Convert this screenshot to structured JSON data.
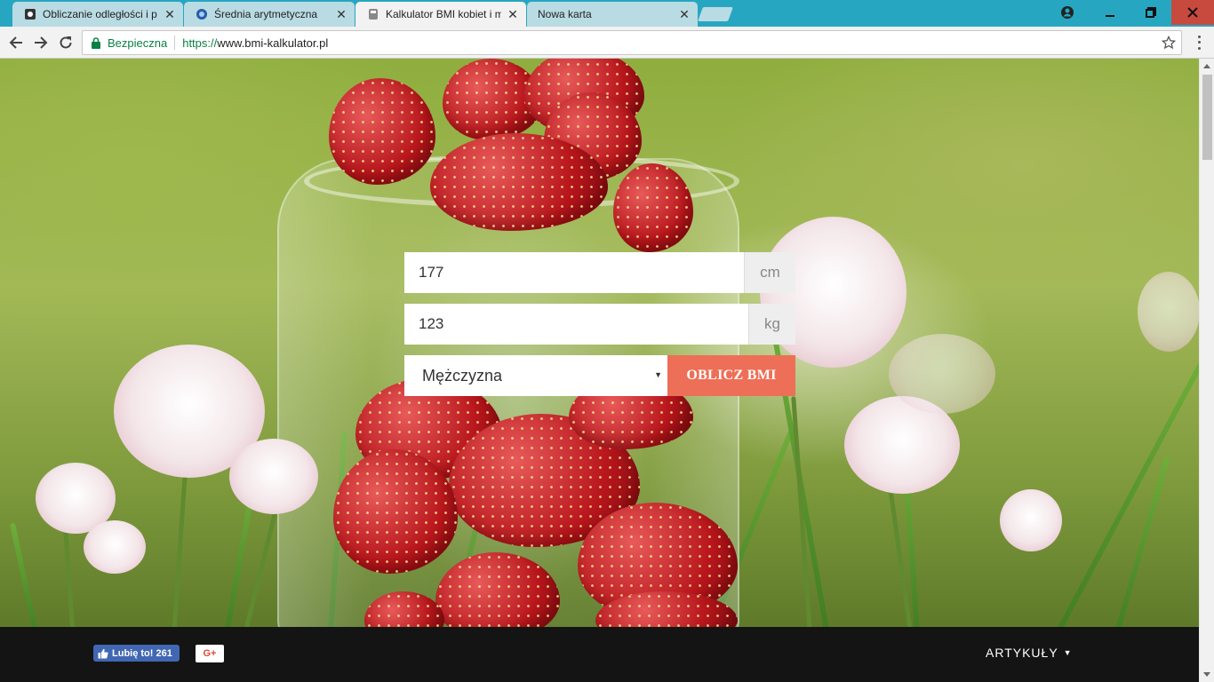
{
  "browser": {
    "tabs": [
      {
        "label": "Obliczanie odległości i p"
      },
      {
        "label": "Średnia arytmetyczna"
      },
      {
        "label": "Kalkulator BMI kobiet i m"
      },
      {
        "label": "Nowa karta"
      }
    ],
    "security_label": "Bezpieczna",
    "url_scheme": "https://",
    "url_host": "www.bmi-kalkulator.pl"
  },
  "form": {
    "height_value": "177",
    "height_unit": "cm",
    "weight_value": "123",
    "weight_unit": "kg",
    "gender_selected": "Mężczyzna",
    "submit_label": "OBLICZ BMI"
  },
  "footer": {
    "like_label": "Lubię to! 261",
    "gplus_label": "G+",
    "articles_label": "ARTYKUŁY"
  },
  "colors": {
    "tabbar": "#27a6c2",
    "submit": "#ee6f57",
    "footer": "#141414",
    "secure_green": "#0b8043"
  }
}
